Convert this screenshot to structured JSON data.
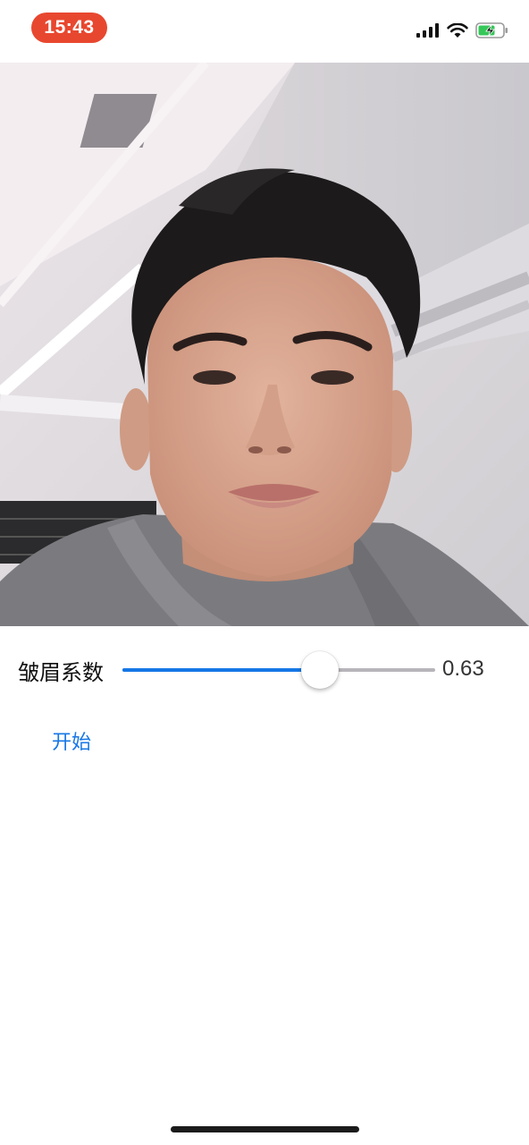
{
  "status_bar": {
    "time": "15:43",
    "time_pill_color": "#e8472f",
    "icons": [
      "signal-icon",
      "wifi-icon",
      "battery-charging-icon"
    ],
    "battery_color": "#36c759"
  },
  "camera": {
    "content": "live-camera-preview"
  },
  "slider": {
    "label": "皱眉系数",
    "value_text": "0.63",
    "value": 0.63,
    "fill_color": "#1677e6"
  },
  "start_button": {
    "label": "开始"
  }
}
